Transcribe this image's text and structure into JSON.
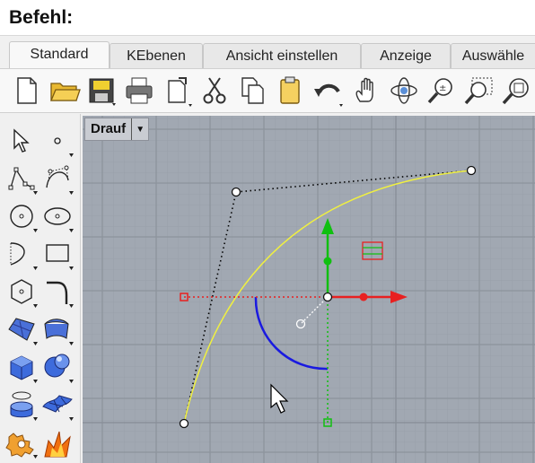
{
  "command": {
    "label": "Befehl:"
  },
  "tabs": [
    {
      "label": "Standard",
      "active": true
    },
    {
      "label": "KEbenen",
      "active": false
    },
    {
      "label": "Ansicht einstellen",
      "active": false
    },
    {
      "label": "Anzeige",
      "active": false
    },
    {
      "label": "Auswähle",
      "active": false
    }
  ],
  "toolbar": {
    "icons": [
      "new-file-icon",
      "open-folder-icon",
      "save-icon",
      "print-icon",
      "export-icon",
      "cut-icon",
      "copy-icon",
      "paste-icon",
      "undo-icon",
      "pan-hand-icon",
      "rotate-view-icon",
      "zoom-dynamic-icon",
      "zoom-window-icon",
      "zoom-extents-icon"
    ]
  },
  "sidebar": {
    "icons": [
      "select-arrow-icon",
      "point-icon",
      "polyline-icon",
      "curve-icon",
      "circle-icon",
      "ellipse-icon",
      "arc-icon",
      "rectangle-icon",
      "polygon-icon",
      "fillet-icon",
      "surface-icon",
      "loft-icon",
      "box-icon",
      "sphere-icon",
      "cylinder-icon",
      "mesh-icon",
      "gear-icon",
      "flame-icon"
    ]
  },
  "viewport": {
    "name": "Drauf",
    "dropdown_glyph": "▼"
  },
  "colors": {
    "viewport_bg": "#a1a8b2",
    "grid_minor": "#9aa1ab",
    "grid_major": "#8c939c",
    "curve": "#f0f040",
    "x_axis": "#e82020",
    "y_axis": "#10c010",
    "arc": "#1a1ae0"
  }
}
